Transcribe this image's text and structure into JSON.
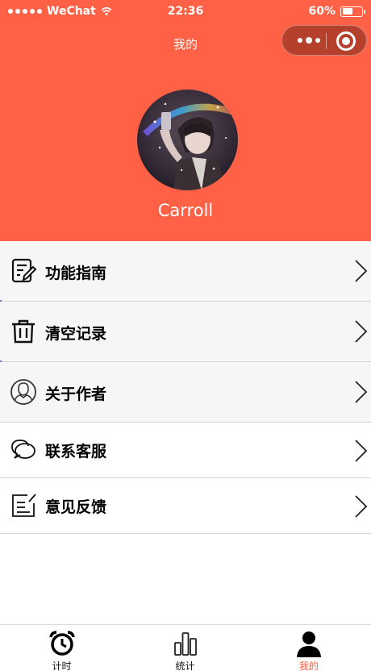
{
  "status_bar": {
    "carrier": "WeChat",
    "time": "22:36",
    "battery": "60%",
    "battery_level": 0.6
  },
  "nav": {
    "title": "我的"
  },
  "profile": {
    "username": "Carroll"
  },
  "menu": [
    {
      "label": "功能指南",
      "icon": "guide-icon"
    },
    {
      "label": "清空记录",
      "icon": "trash-icon"
    },
    {
      "label": "关于作者",
      "icon": "user-circle-icon"
    },
    {
      "label": "联系客服",
      "icon": "chat-bubbles-icon"
    },
    {
      "label": "意见反馈",
      "icon": "feedback-edit-icon"
    }
  ],
  "tabbar": {
    "tabs": [
      {
        "label": "计时",
        "icon": "alarm-clock-icon"
      },
      {
        "label": "统计",
        "icon": "bar-chart-icon"
      },
      {
        "label": "我的",
        "icon": "person-icon"
      }
    ],
    "active_index": 2
  },
  "colors": {
    "brand": "#fe6146",
    "menu_gray": "#f6f6f6",
    "divider": "#d4d4d4"
  }
}
